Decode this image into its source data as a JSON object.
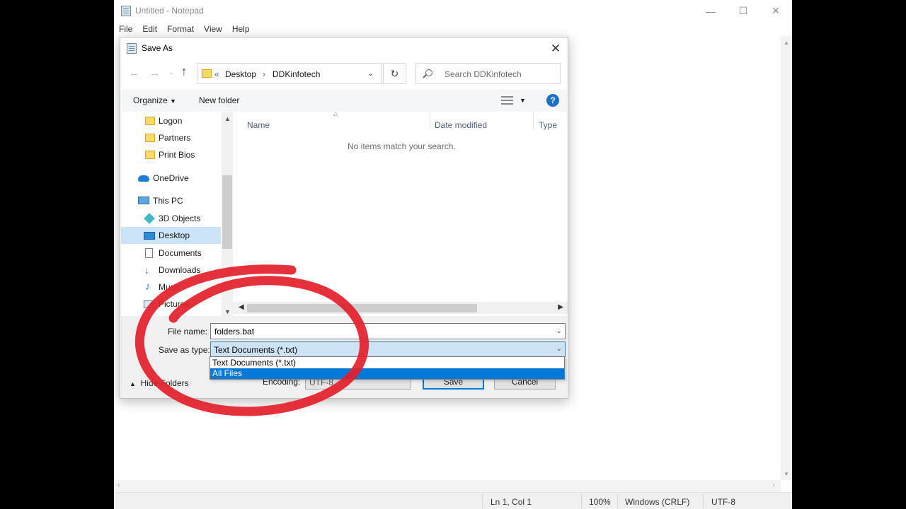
{
  "notepad": {
    "title": "Untitled - Notepad",
    "menu": [
      "File",
      "Edit",
      "Format",
      "View",
      "Help"
    ],
    "status": {
      "position": "Ln 1, Col 1",
      "zoom": "100%",
      "line_ending": "Windows (CRLF)",
      "encoding": "UTF-8"
    }
  },
  "dialog": {
    "title": "Save As",
    "address": {
      "overflow": "«",
      "crumbs": [
        "Desktop",
        "DDKinfotech"
      ]
    },
    "search": {
      "placeholder": "Search DDKinfotech"
    },
    "toolbar": {
      "organize": "Organize",
      "new_folder": "New folder"
    },
    "nav": [
      {
        "label": "Logon",
        "icon": "folder-icon"
      },
      {
        "label": "Partners",
        "icon": "folder-icon"
      },
      {
        "label": "Print Bios",
        "icon": "folder-icon"
      },
      {
        "label": "OneDrive",
        "icon": "onedrive-icon"
      },
      {
        "label": "This PC",
        "icon": "this-pc-icon"
      },
      {
        "label": "3D Objects",
        "icon": "3d-objects-icon"
      },
      {
        "label": "Desktop",
        "icon": "desktop-icon",
        "selected": true
      },
      {
        "label": "Documents",
        "icon": "documents-icon"
      },
      {
        "label": "Downloads",
        "icon": "downloads-icon"
      },
      {
        "label": "Music",
        "icon": "music-icon"
      },
      {
        "label": "Pictures",
        "icon": "pictures-icon"
      }
    ],
    "columns": [
      "Name",
      "Date modified",
      "Type"
    ],
    "empty_message": "No items match your search.",
    "file_name_label": "File name:",
    "file_name_value": "folders.bat",
    "save_type_label": "Save as type:",
    "save_type_value": "Text Documents (*.txt)",
    "save_type_options": [
      "Text Documents (*.txt)",
      "All Files"
    ],
    "save_type_highlighted": "All Files",
    "hide_folders": "Hide Folders",
    "encoding_label": "Encoding:",
    "encoding_value": "UTF-8",
    "save_button": "Save",
    "cancel_button": "Cancel"
  },
  "colors": {
    "accent": "#0078d7",
    "annotation": "#e3202a",
    "selection": "#cce4f7"
  }
}
